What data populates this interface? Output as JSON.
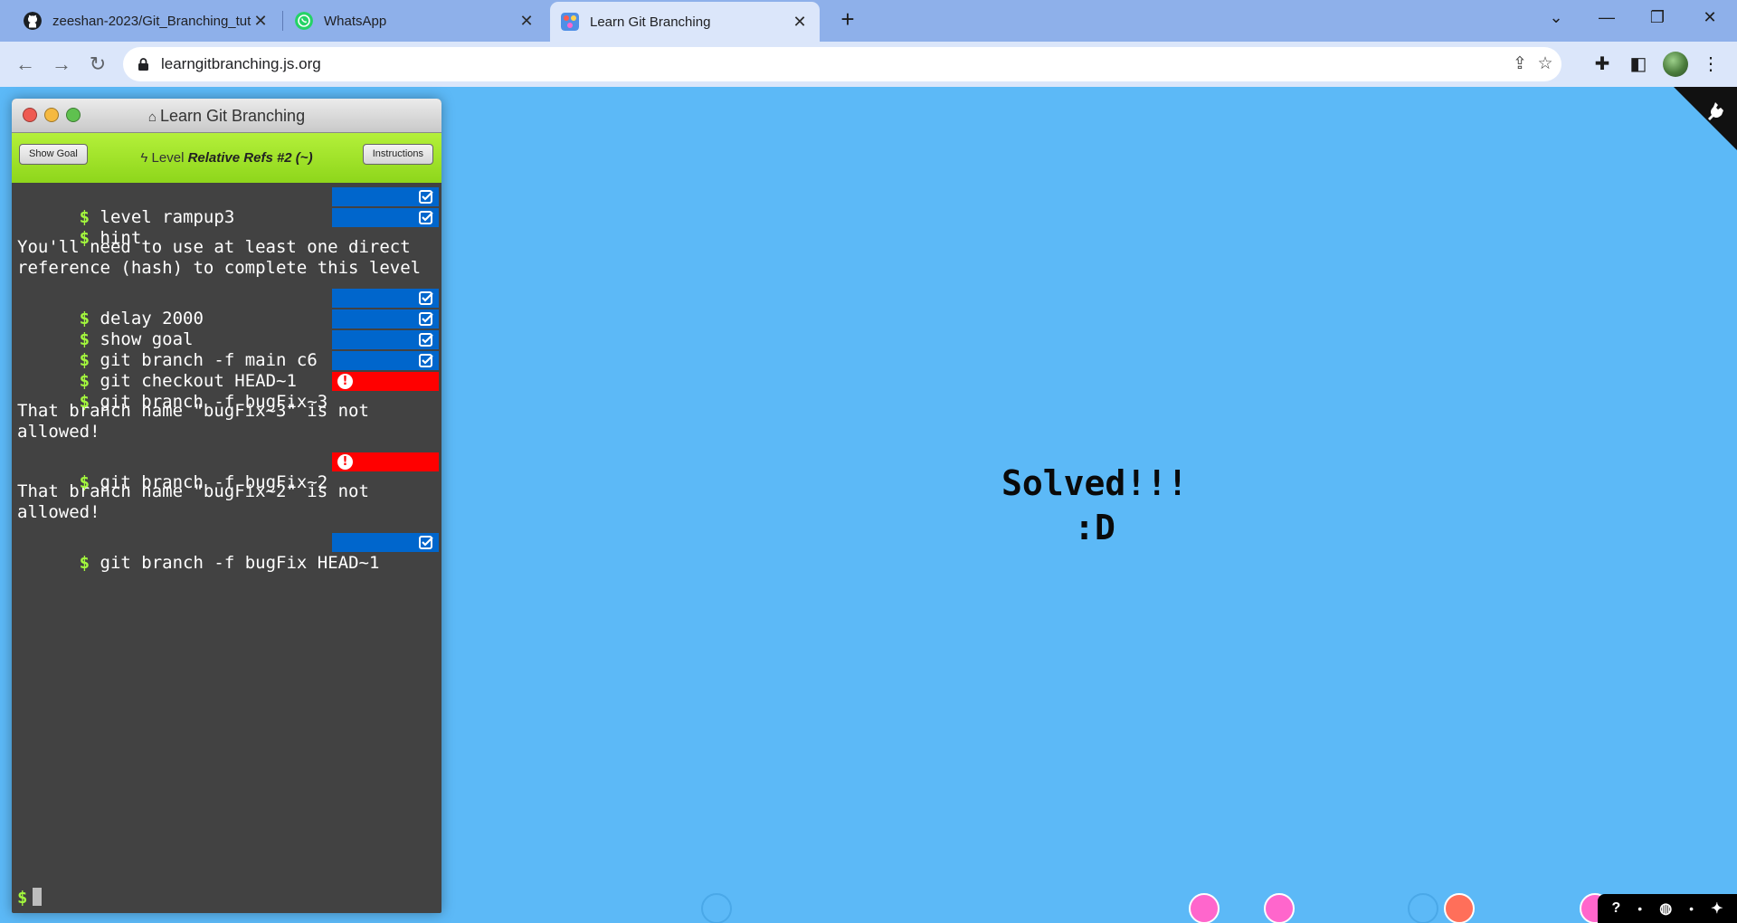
{
  "browser": {
    "tabs": [
      {
        "title": "zeeshan-2023/Git_Branching_tut",
        "icon": "github-icon",
        "active": false
      },
      {
        "title": "WhatsApp",
        "icon": "whatsapp-icon",
        "active": false
      },
      {
        "title": "Learn Git Branching",
        "icon": "learngit-icon",
        "active": true
      }
    ],
    "new_tab_glyph": "+",
    "url": "learngitbranching.js.org",
    "window_controls": [
      "⌄",
      "—",
      "❐",
      "✕"
    ]
  },
  "terminal": {
    "title": "Learn Git Branching",
    "show_goal_label": "Show Goal",
    "instructions_label": "Instructions",
    "level_prefix": "Level",
    "level_name": "Relative Refs #2 (~)",
    "commands": [
      {
        "text": "level rampup3",
        "status": "ok"
      },
      {
        "text": "hint",
        "status": "ok"
      },
      {
        "text": "delay 2000",
        "status": "ok"
      },
      {
        "text": "show goal",
        "status": "ok"
      },
      {
        "text": "git branch -f main c6",
        "status": "ok"
      },
      {
        "text": "git checkout HEAD~1",
        "status": "ok"
      },
      {
        "text": "git branch -f bugFix~3",
        "status": "error"
      },
      {
        "text": "git branch -f bugFix~2",
        "status": "error"
      },
      {
        "text": "git branch -f bugFix HEAD~1",
        "status": "ok"
      }
    ],
    "messages": [
      "You'll need to use at least one direct\nreference (hash) to complete this level",
      "That branch name \"bugFix~3\" is not\nallowed!",
      "That branch name \"bugFix~2\" is not\nallowed!"
    ],
    "prompt_symbol": "$"
  },
  "canvas": {
    "solved_line1": "Solved!!!",
    "solved_line2": ":D"
  },
  "colors": {
    "canvas_bg": "#5cb9f7",
    "status_ok": "#0066cc",
    "status_error": "#ff0000",
    "prompt": "#a3f73d",
    "level_bar": "#8ed61b",
    "node_pink": "#ff66cc",
    "node_coral": "#ff6f5a"
  }
}
